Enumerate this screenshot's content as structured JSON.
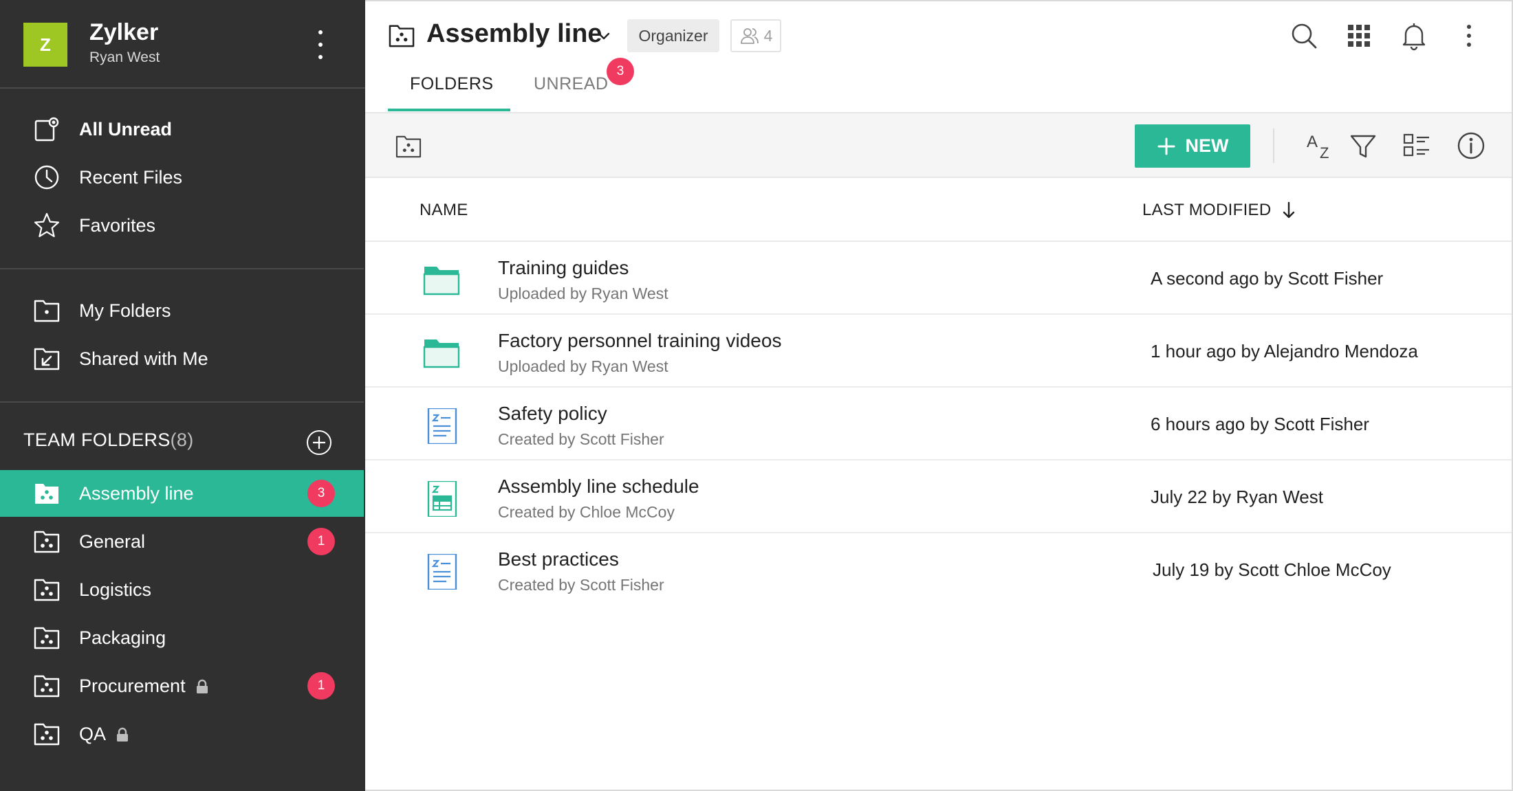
{
  "org": {
    "logo_letter": "Z",
    "name": "Zylker",
    "user": "Ryan West"
  },
  "nav": {
    "all_unread": "All Unread",
    "recent_files": "Recent Files",
    "favorites": "Favorites",
    "my_folders": "My Folders",
    "shared_with_me": "Shared with Me"
  },
  "team_folders": {
    "heading": "TEAM FOLDERS",
    "count": "(8)",
    "items": [
      {
        "label": "Assembly line",
        "badge": "3",
        "active": true
      },
      {
        "label": "General",
        "badge": "1"
      },
      {
        "label": "Logistics",
        "badge": ""
      },
      {
        "label": "Packaging",
        "badge": ""
      },
      {
        "label": "Procurement",
        "badge": "1",
        "locked": true
      },
      {
        "label": "QA",
        "badge": "",
        "locked": true
      }
    ]
  },
  "header": {
    "title": "Assembly line",
    "role": "Organizer",
    "member_count": "4"
  },
  "tabs": {
    "folders": "FOLDERS",
    "unread": "UNREAD",
    "unread_badge": "3"
  },
  "toolbar": {
    "new_label": "NEW",
    "sort_label_a": "A",
    "sort_label_z": "Z"
  },
  "columns": {
    "name": "NAME",
    "last_modified": "LAST MODIFIED"
  },
  "files": [
    {
      "name": "Training guides",
      "sub": "Uploaded by Ryan West",
      "modified": "A second ago by Scott Fisher",
      "type": "folder"
    },
    {
      "name": "Factory personnel training videos",
      "sub": "Uploaded by Ryan West",
      "modified": "1 hour ago by Alejandro Mendoza",
      "type": "folder"
    },
    {
      "name": "Safety policy",
      "sub": "Created by Scott Fisher",
      "modified": "6 hours ago by Scott Fisher",
      "type": "document"
    },
    {
      "name": "Assembly line schedule",
      "sub": "Created by Chloe McCoy",
      "modified": "July 22 by Ryan West",
      "type": "spreadsheet"
    },
    {
      "name": "Best practices",
      "sub": "Created by Scott Fisher",
      "modified": "July 19 by Scott Chloe McCoy",
      "type": "document"
    }
  ],
  "colors": {
    "sidebar_bg": "#303030",
    "accent": "#2bb897",
    "badge": "#f03a5f",
    "logo": "#9ec724",
    "doc_blue": "#4a90d9"
  }
}
